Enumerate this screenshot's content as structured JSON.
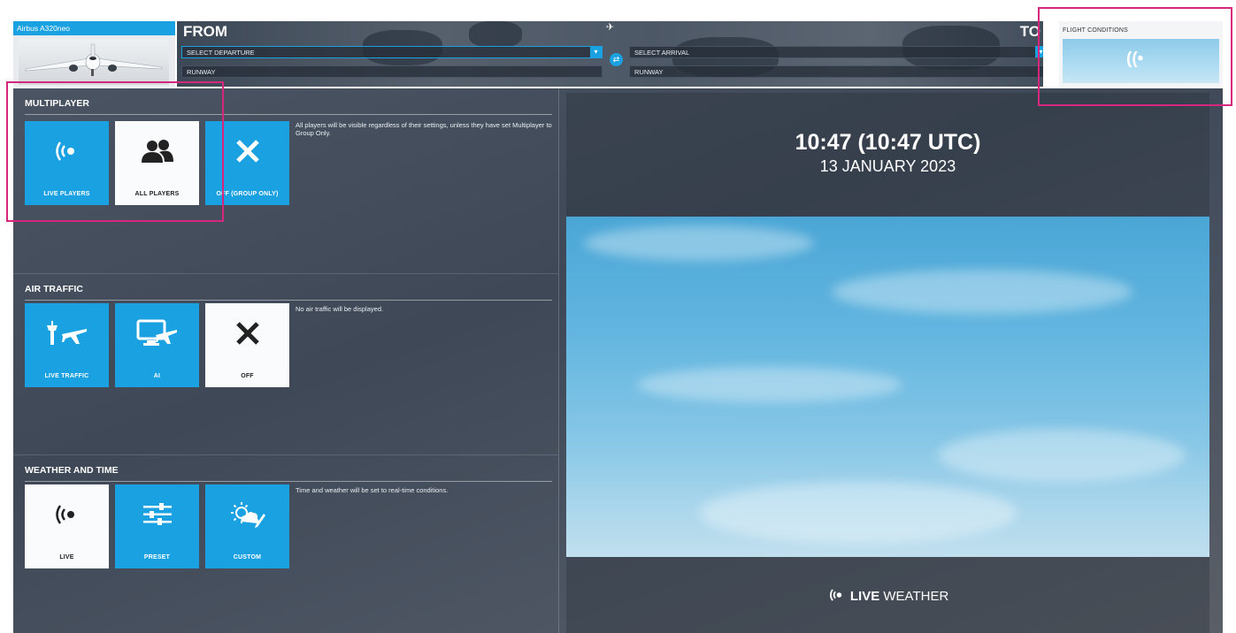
{
  "colors": {
    "accent": "#1aa1e2",
    "highlight": "#d6267e",
    "panel": "#46505e"
  },
  "aircraft": {
    "name": "Airbus A320neo",
    "icon": "airplane-thumbnail"
  },
  "route": {
    "from_label": "FROM",
    "to_label": "TO",
    "departure_placeholder": "SELECT DEPARTURE",
    "departure_runway": "RUNWAY",
    "arrival_placeholder": "SELECT ARRIVAL",
    "arrival_runway": "RUNWAY",
    "swap_icon": "swap-icon"
  },
  "flight_conditions": {
    "title": "FLIGHT CONDITIONS",
    "icon": "live-broadcast-icon"
  },
  "multiplayer": {
    "title": "MULTIPLAYER",
    "description": "All players will be visible regardless of their settings, unless they have set Multiplayer to Group Only.",
    "options": [
      {
        "label": "LIVE PLAYERS",
        "icon": "live-broadcast-icon",
        "selected": false
      },
      {
        "label": "ALL PLAYERS",
        "icon": "people-icon",
        "selected": true
      },
      {
        "label": "OFF (GROUP ONLY)",
        "icon": "close-icon",
        "selected": false
      }
    ]
  },
  "air_traffic": {
    "title": "AIR TRAFFIC",
    "description": "No air traffic will be displayed.",
    "options": [
      {
        "label": "LIVE TRAFFIC",
        "icon": "tower-plane-icon",
        "selected": false
      },
      {
        "label": "AI",
        "icon": "computer-plane-icon",
        "selected": false
      },
      {
        "label": "OFF",
        "icon": "close-icon",
        "selected": true
      }
    ]
  },
  "weather_time": {
    "title": "WEATHER AND TIME",
    "description": "Time and weather will be set to real-time conditions.",
    "options": [
      {
        "label": "LIVE",
        "icon": "live-broadcast-icon",
        "selected": true
      },
      {
        "label": "PRESET",
        "icon": "sliders-icon",
        "selected": false
      },
      {
        "label": "CUSTOM",
        "icon": "sun-cloud-edit-icon",
        "selected": false
      }
    ]
  },
  "preview": {
    "time": "10:47 (10:47 UTC)",
    "date": "13 JANUARY 2023",
    "live_word": "LIVE",
    "weather_word": "WEATHER"
  }
}
